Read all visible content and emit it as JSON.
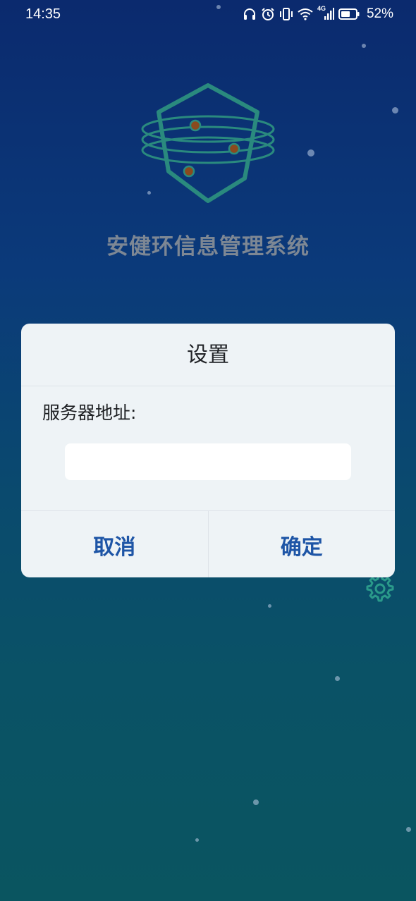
{
  "status_bar": {
    "time": "14:35",
    "battery_percent": "52%",
    "network_label": "4G",
    "icons": [
      "headphones-icon",
      "alarm-icon",
      "vibrate-icon",
      "wifi-icon",
      "signal-icon",
      "battery-icon"
    ]
  },
  "app": {
    "title": "安健环信息管理系统",
    "logo_icon": "hexagon-orbit-logo-icon"
  },
  "dialog": {
    "title": "设置",
    "field_label": "服务器地址:",
    "field_value": "",
    "field_placeholder": "",
    "cancel_label": "取消",
    "confirm_label": "确定"
  },
  "colors": {
    "background_top": "#0b2a6e",
    "background_bottom": "#0a5560",
    "dialog_bg": "#eef3f6",
    "accent_button": "#1e55a6",
    "logo_teal": "#2a8a7e",
    "logo_dot": "#8a4a1e",
    "title_gray": "#7d8794"
  }
}
